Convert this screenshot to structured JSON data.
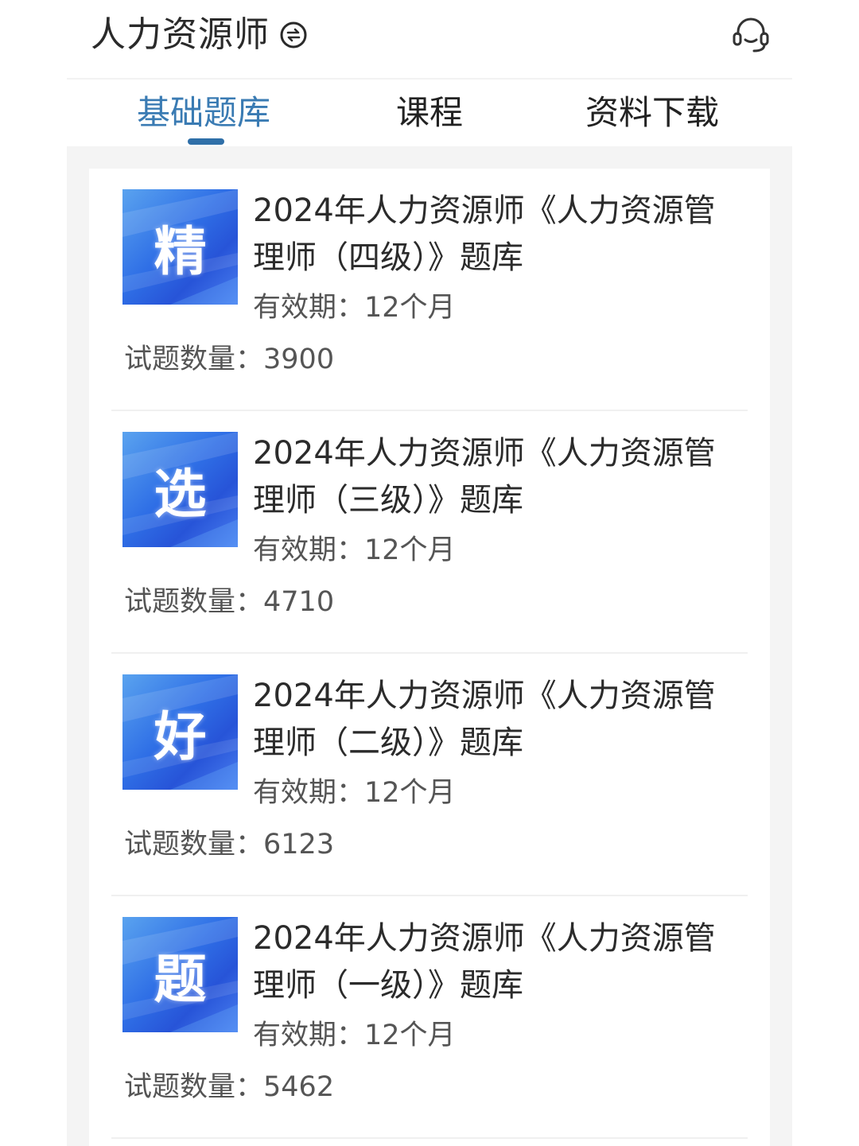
{
  "header": {
    "title": "人力资源师",
    "switch_icon": "switch-icon",
    "support_icon": "headset-icon"
  },
  "tabs": [
    {
      "label": "基础题库",
      "active": true
    },
    {
      "label": "课程",
      "active": false
    },
    {
      "label": "资料下载",
      "active": false
    }
  ],
  "colors": {
    "accent": "#3a7bb3",
    "thumb_blue": "#2f6fe6"
  },
  "items": [
    {
      "thumb_char": "精",
      "title": "2024年人力资源师《人力资源管理师（四级）》题库",
      "validity_label": "有效期：",
      "validity_value": "12个月",
      "count_label": "试题数量：",
      "count_value": "3900"
    },
    {
      "thumb_char": "选",
      "title": "2024年人力资源师《人力资源管理师（三级）》题库",
      "validity_label": "有效期：",
      "validity_value": "12个月",
      "count_label": "试题数量：",
      "count_value": "4710"
    },
    {
      "thumb_char": "好",
      "title": "2024年人力资源师《人力资源管理师（二级）》题库",
      "validity_label": "有效期：",
      "validity_value": "12个月",
      "count_label": "试题数量：",
      "count_value": "6123"
    },
    {
      "thumb_char": "题",
      "title": "2024年人力资源师《人力资源管理师（一级）》题库",
      "validity_label": "有效期：",
      "validity_value": "12个月",
      "count_label": "试题数量：",
      "count_value": "5462"
    }
  ]
}
